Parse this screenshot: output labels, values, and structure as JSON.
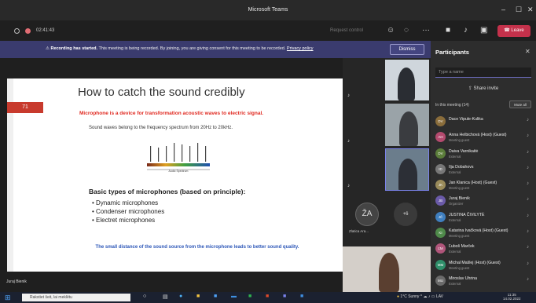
{
  "app": {
    "title": "Microsoft Teams"
  },
  "meeting": {
    "timer": "02:41:43",
    "request_control": "Request control",
    "leave_label": "Leave",
    "banner_bold": "Recording has started.",
    "banner_text": "This meeting is being recorded. By joining, you are giving consent for this meeting to be recorded.",
    "banner_link": "Privacy policy",
    "dismiss_label": "Dismiss",
    "presenter_name": "Juraj Bienik"
  },
  "slide": {
    "number": "71",
    "title": "How to catch the sound credibly",
    "definition": "Microphone is a device for transformation acoustic waves to electric signal.",
    "spectrum_text": "Sound waves belong to the frequency spectrum from 20Hz to 20kHz.",
    "spectrum_caption": "Audio Spectrum",
    "basic_types": "Basic types of microphones (based on principle):",
    "items": [
      "Dynamic microphones",
      "Condenser microphones",
      "Electret microphones"
    ],
    "note": "The small distance of the sound source from the microphone leads to better sound quality."
  },
  "gallery": {
    "avatar_initials": "ŽA",
    "more_count": "+6",
    "avatar_name": "Zlatica Ara..."
  },
  "participants": {
    "header": "Participants",
    "search_placeholder": "Type a name",
    "share_invite": "Share invite",
    "in_meeting": "In this meeting (14)",
    "mute_all": "Mute all",
    "list": [
      {
        "initials": "DV",
        "name": "Dace Vipule-Kulika",
        "role": "",
        "color": "#8a6d3b"
      },
      {
        "initials": "AH",
        "name": "Anna Helbichová (Host) (Guest)",
        "role": "Meeting guest",
        "color": "#b44a6e"
      },
      {
        "initials": "DV",
        "name": "Daiva Varnikaitė",
        "role": "External",
        "color": "#5b7d3a"
      },
      {
        "initials": "ID",
        "name": "Ilja Dobahovs",
        "role": "External",
        "color": "#777777"
      },
      {
        "initials": "JK",
        "name": "Jan Klanica (Host) (Guest)",
        "role": "Meeting guest",
        "color": "#9a8b5a"
      },
      {
        "initials": "JB",
        "name": "Juraj Bienik",
        "role": "Organizer",
        "role2": "External",
        "color": "#6a5aa8"
      },
      {
        "initials": "JČ",
        "name": "JUSTINA ČIVILYTĖ",
        "role": "External",
        "color": "#3f7fbf"
      },
      {
        "initials": "KI",
        "name": "Katarina Ivačková (Host) (Guest)",
        "role": "Meeting guest",
        "color": "#4f8a4a"
      },
      {
        "initials": "ĽM",
        "name": "Ľuboš Marček",
        "role": "External",
        "color": "#b0557a"
      },
      {
        "initials": "MM",
        "name": "Michal Mašlej (Host) (Guest)",
        "role": "Meeting guest",
        "color": "#2f8f6a"
      },
      {
        "initials": "MU",
        "name": "Miroslav Uhrina",
        "role": "External",
        "color": "#6a6a6a"
      }
    ]
  },
  "taskbar": {
    "search_placeholder": "Rakstiet šeit, lai meklētu",
    "weather": "1°C Sunny",
    "lang": "LAV",
    "time": "11:35",
    "date": "14.02.2022"
  }
}
